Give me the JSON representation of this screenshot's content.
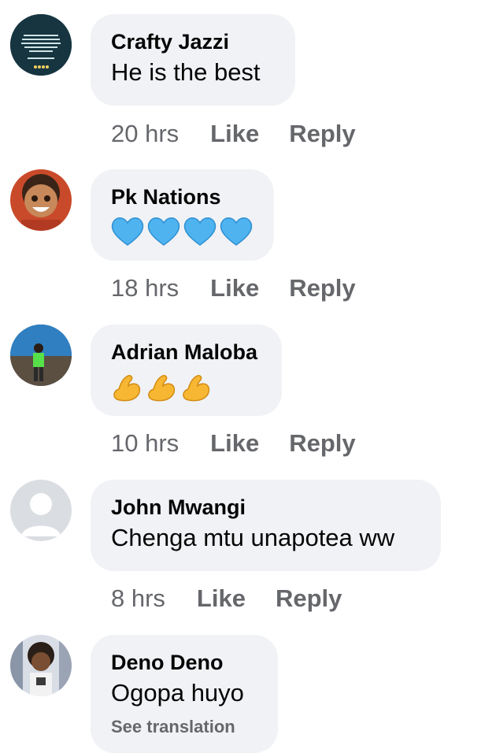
{
  "comments": [
    {
      "author": "Crafty Jazzi",
      "text": "He is the best",
      "time": "20 hrs",
      "like_label": "Like",
      "reply_label": "Reply"
    },
    {
      "author": "Pk Nations",
      "emoji": "blue-heart",
      "emoji_count": 4,
      "time": "18 hrs",
      "like_label": "Like",
      "reply_label": "Reply"
    },
    {
      "author": "Adrian Maloba",
      "emoji": "flexed-biceps",
      "emoji_count": 3,
      "time": "10 hrs",
      "like_label": "Like",
      "reply_label": "Reply"
    },
    {
      "author": "John Mwangi",
      "text": "Chenga mtu unapotea ww",
      "time": "8 hrs",
      "like_label": "Like",
      "reply_label": "Reply"
    },
    {
      "author": "Deno Deno",
      "text": "Ogopa huyo",
      "translation_label": "See translation"
    }
  ],
  "colors": {
    "bubble": "#f0f2f5",
    "name": "#050505",
    "meta": "#65676b",
    "heart": "#4fb3f0",
    "bicep": "#f7b733"
  }
}
